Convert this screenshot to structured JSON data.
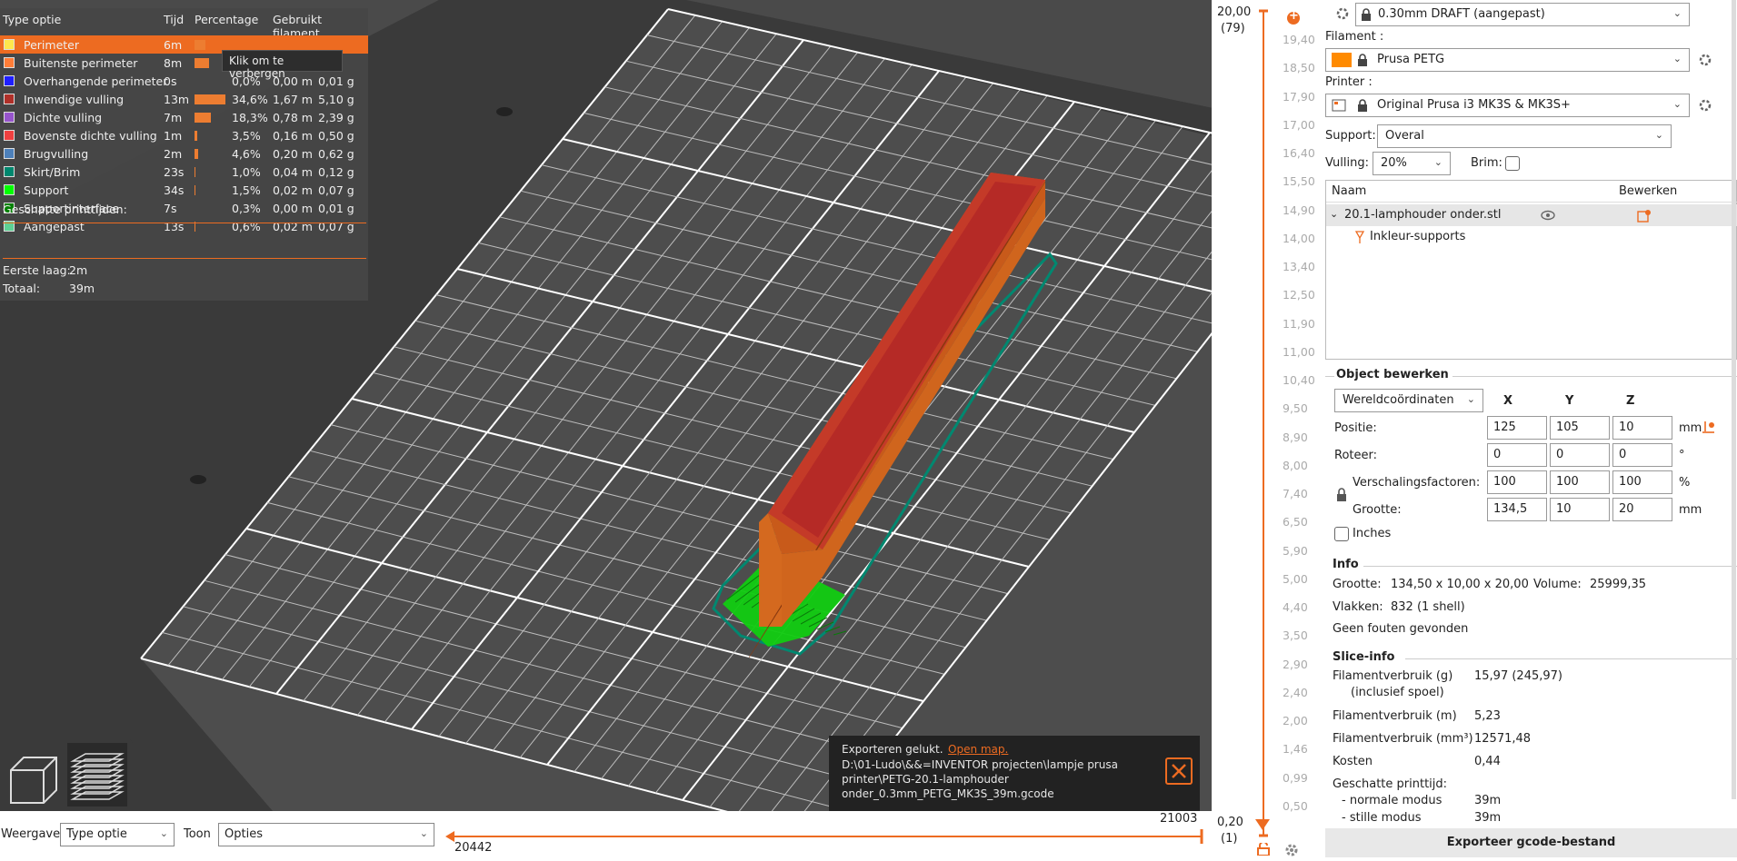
{
  "legend": {
    "headers": {
      "type": "Type optie",
      "time": "Tijd",
      "percentage": "Percentage",
      "filament": "Gebruikt filament"
    },
    "rows": [
      {
        "name": "Perimeter",
        "time": "6m",
        "pct": "",
        "meters": "",
        "grams": "",
        "color": "#ffe64d",
        "bar": 0.35,
        "selected": true
      },
      {
        "name": "Buitenste perimeter",
        "time": "8m",
        "pct": "",
        "meters": "",
        "grams": "g",
        "color": "#ff7d38",
        "bar": 0.48
      },
      {
        "name": "Overhangende perimeter",
        "time": "0s",
        "pct": "0,0%",
        "meters": "0,00 m",
        "grams": "0,01 g",
        "color": "#1f1fff",
        "bar": 0.0
      },
      {
        "name": "Inwendige vulling",
        "time": "13m",
        "pct": "34,6%",
        "meters": "1,67 m",
        "grams": "5,10 g",
        "color": "#b03029",
        "bar": 1.0
      },
      {
        "name": "Dichte vulling",
        "time": "7m",
        "pct": "18,3%",
        "meters": "0,78 m",
        "grams": "2,39 g",
        "color": "#9654cc",
        "bar": 0.53
      },
      {
        "name": "Bovenste dichte vulling",
        "time": "1m",
        "pct": "3,5%",
        "meters": "0,16 m",
        "grams": "0,50 g",
        "color": "#f04040",
        "bar": 0.1
      },
      {
        "name": "Brugvulling",
        "time": "2m",
        "pct": "4,6%",
        "meters": "0,20 m",
        "grams": "0,62 g",
        "color": "#4d80ba",
        "bar": 0.13
      },
      {
        "name": "Skirt/Brim",
        "time": "23s",
        "pct": "1,0%",
        "meters": "0,04 m",
        "grams": "0,12 g",
        "color": "#00876e",
        "bar": 0.03
      },
      {
        "name": "Support",
        "time": "34s",
        "pct": "1,5%",
        "meters": "0,02 m",
        "grams": "0,07 g",
        "color": "#00ff00",
        "bar": 0.04
      },
      {
        "name": "Supportinterface",
        "time": "7s",
        "pct": "0,3%",
        "meters": "0,00 m",
        "grams": "0,01 g",
        "color": "#008000",
        "bar": 0.01
      },
      {
        "name": "Aangepast",
        "time": "13s",
        "pct": "0,6%",
        "meters": "0,02 m",
        "grams": "0,07 g",
        "color": "#5ed194",
        "bar": 0.02
      }
    ],
    "tooltip": "Klik om te verbergen",
    "estimated_title": "Geschatte printtijden:",
    "first_layer_label": "Eerste laag:",
    "first_layer_value": "2m",
    "total_label": "Totaal:",
    "total_value": "39m"
  },
  "notification": {
    "title": "Exporteren gelukt.",
    "link": "Open map.",
    "path": "D:\\01-Ludo\\&&=INVENTOR projecten\\lampje prusa printer\\PETG-20.1-lamphouder onder_0.3mm_PETG_MK3S_39m.gcode"
  },
  "vertical_slider": {
    "top_value": "20,00",
    "top_layer": "(79)",
    "bottom_value": "0,20",
    "bottom_layer": "(1)",
    "ticks": [
      "19,40",
      "18,50",
      "17,90",
      "17,00",
      "16,40",
      "15,50",
      "14,90",
      "14,00",
      "13,40",
      "12,50",
      "11,90",
      "11,00",
      "10,40",
      "9,50",
      "8,90",
      "8,00",
      "7,40",
      "6,50",
      "5,90",
      "5,00",
      "4,40",
      "3,50",
      "2,90",
      "2,40",
      "2,00",
      "1,46",
      "0,99",
      "0,50"
    ]
  },
  "bottom_bar": {
    "view_label": "Weergave",
    "view_value": "Type optie",
    "show_label": "Toon",
    "show_value": "Opties",
    "h_right_value": "21003",
    "h_left_value": "20442"
  },
  "panel": {
    "print_profile": "0.30mm DRAFT (aangepast)",
    "filament_label": "Filament :",
    "filament_value": "Prusa PETG",
    "filament_color": "#ff8a00",
    "printer_label": "Printer :",
    "printer_value": "Original Prusa i3 MK3S & MK3S+",
    "support_label": "Support:",
    "support_value": "Overal",
    "infill_label": "Vulling:",
    "infill_value": "20%",
    "brim_label": "Brim:",
    "list_header_name": "Naam",
    "list_header_edit": "Bewerken",
    "object_name": "20.1-lamphouder onder.stl",
    "object_child": "Inkleur-supports",
    "object_edit_title": "Object bewerken",
    "coord_system": "Wereldcoördinaten",
    "axis_x": "X",
    "axis_y": "Y",
    "axis_z": "Z",
    "position_label": "Positie:",
    "position": [
      "125",
      "105",
      "10"
    ],
    "position_unit": "mm",
    "rotate_label": "Roteer:",
    "rotate": [
      "0",
      "0",
      "0"
    ],
    "rotate_unit": "°",
    "scale_label": "Verschalingsfactoren:",
    "scale": [
      "100",
      "100",
      "100"
    ],
    "scale_unit": "%",
    "size_label": "Grootte:",
    "size": [
      "134,5",
      "10",
      "20"
    ],
    "size_unit": "mm",
    "inches_label": "Inches",
    "info_title": "Info",
    "info_size_label": "Grootte:",
    "info_size_value": "134,50 x 10,00 x 20,00",
    "info_volume_label": "Volume:",
    "info_volume_value": "25999,35",
    "info_facets_label": "Vlakken:",
    "info_facets_value": "832 (1 shell)",
    "info_errors": "Geen fouten gevonden",
    "slice_title": "Slice-info",
    "fil_g_label": "Filamentverbruik (g)",
    "fil_g_sub": "(inclusief spoel)",
    "fil_g_value": "15,97 (245,97)",
    "fil_m_label": "Filamentverbruik (m)",
    "fil_m_value": "5,23",
    "fil_mm3_label": "Filamentverbruik (mm³)",
    "fil_mm3_value": "12571,48",
    "cost_label": "Kosten",
    "cost_value": "0,44",
    "est_label": "Geschatte printtijd:",
    "normal_label": "- normale modus",
    "normal_value": "39m",
    "silent_label": "- stille modus",
    "silent_value": "39m",
    "export_button": "Exporteer gcode-bestand"
  }
}
